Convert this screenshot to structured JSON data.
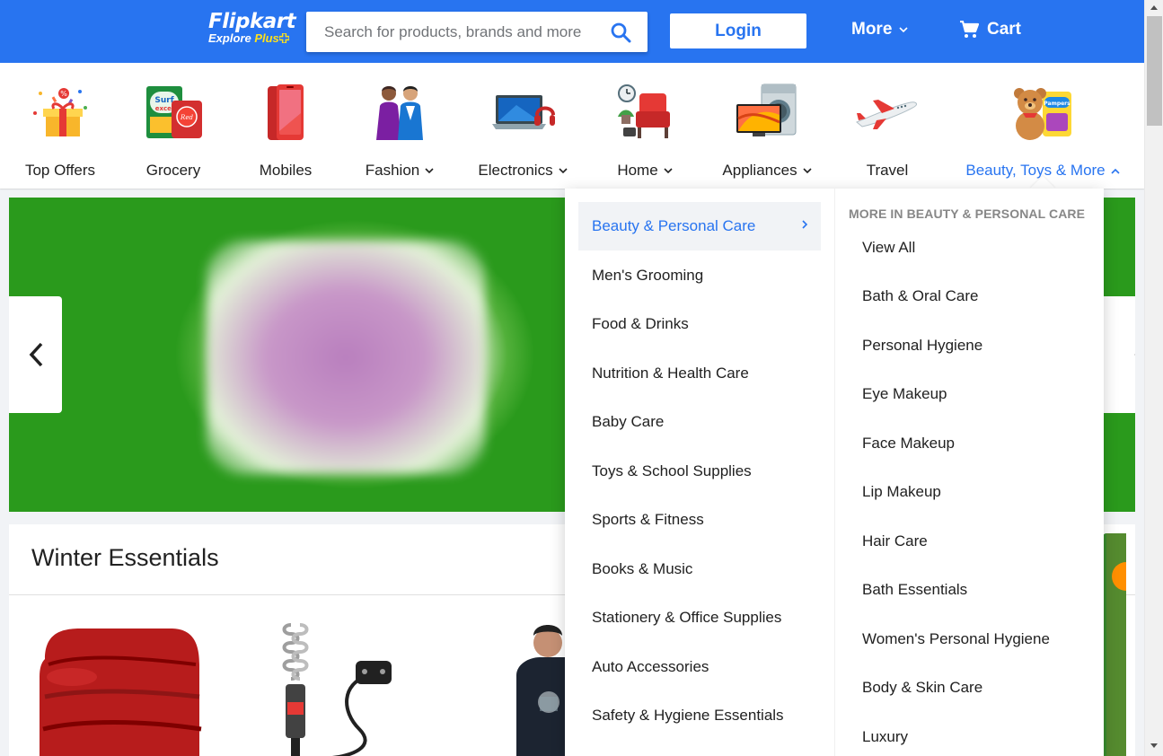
{
  "header": {
    "brand": "Flipkart",
    "tagline": "Explore",
    "tagline_plus": "Plus",
    "search_placeholder": "Search for products, brands and more",
    "login_label": "Login",
    "more_label": "More",
    "cart_label": "Cart",
    "brand_color": "#2874f0",
    "plus_color": "#ffe11b"
  },
  "categories": [
    {
      "label": "Top Offers",
      "icon": "gift-icon",
      "has_menu": false
    },
    {
      "label": "Grocery",
      "icon": "grocery-icon",
      "has_menu": false
    },
    {
      "label": "Mobiles",
      "icon": "mobile-phone-icon",
      "has_menu": false
    },
    {
      "label": "Fashion",
      "icon": "fashion-icon",
      "has_menu": true
    },
    {
      "label": "Electronics",
      "icon": "laptop-icon",
      "has_menu": true
    },
    {
      "label": "Home",
      "icon": "armchair-icon",
      "has_menu": true
    },
    {
      "label": "Appliances",
      "icon": "tv-washer-icon",
      "has_menu": true
    },
    {
      "label": "Travel",
      "icon": "airplane-icon",
      "has_menu": false
    },
    {
      "label": "Beauty, Toys & More",
      "icon": "teddy-bear-icon",
      "has_menu": true,
      "active": true
    }
  ],
  "dropdown": {
    "primary": [
      "Beauty & Personal Care",
      "Men's Grooming",
      "Food & Drinks",
      "Nutrition & Health Care",
      "Baby Care",
      "Toys & School Supplies",
      "Sports & Fitness",
      "Books & Music",
      "Stationery & Office Supplies",
      "Auto Accessories",
      "Safety & Hygiene Essentials"
    ],
    "active_index": 0,
    "secondary_heading": "MORE IN BEAUTY & PERSONAL CARE",
    "secondary": [
      "View All",
      "Bath & Oral Care",
      "Personal Hygiene",
      "Eye Makeup",
      "Face Makeup",
      "Lip Makeup",
      "Hair Care",
      "Bath Essentials",
      "Women's Personal Hygiene",
      "Body & Skin Care",
      "Luxury"
    ]
  },
  "winter": {
    "title": "Winter Essentials"
  }
}
